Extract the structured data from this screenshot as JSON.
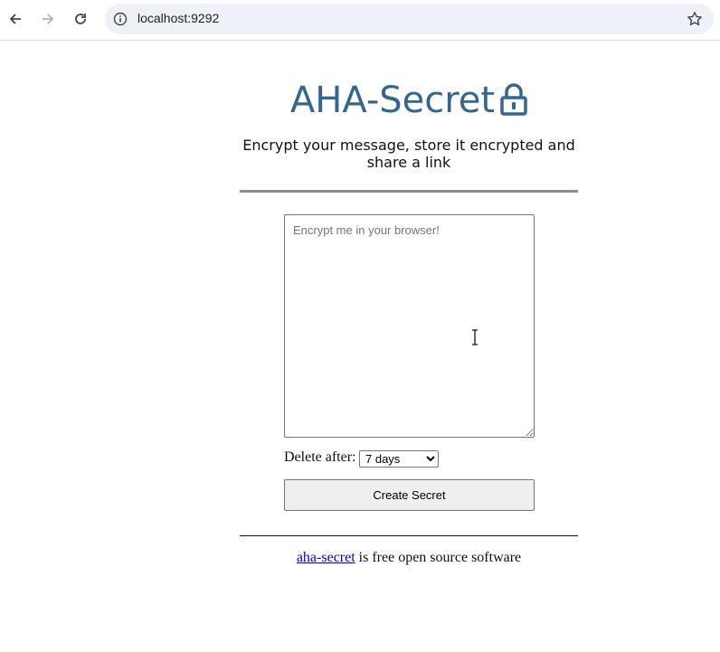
{
  "browser": {
    "url": "localhost:9292",
    "icons": {
      "back": "arrow-left-icon",
      "forward": "arrow-right-icon",
      "reload": "reload-icon",
      "info": "info-icon",
      "bookmark": "star-icon"
    }
  },
  "page": {
    "title": "AHA-Secret",
    "title_icon": "lock-icon",
    "subtitle": "Encrypt your message, store it encrypted and share a link",
    "form": {
      "placeholder": "Encrypt me in your browser!",
      "value": "",
      "delete_label": "Delete after:",
      "delete_selected": "7 days",
      "submit_label": "Create Secret"
    },
    "footer": {
      "link_text": "aha-secret",
      "rest_text": " is free open source software"
    }
  },
  "colors": {
    "title": "#336791",
    "link": "#0000ee",
    "omnibox": "#eef1f8"
  }
}
